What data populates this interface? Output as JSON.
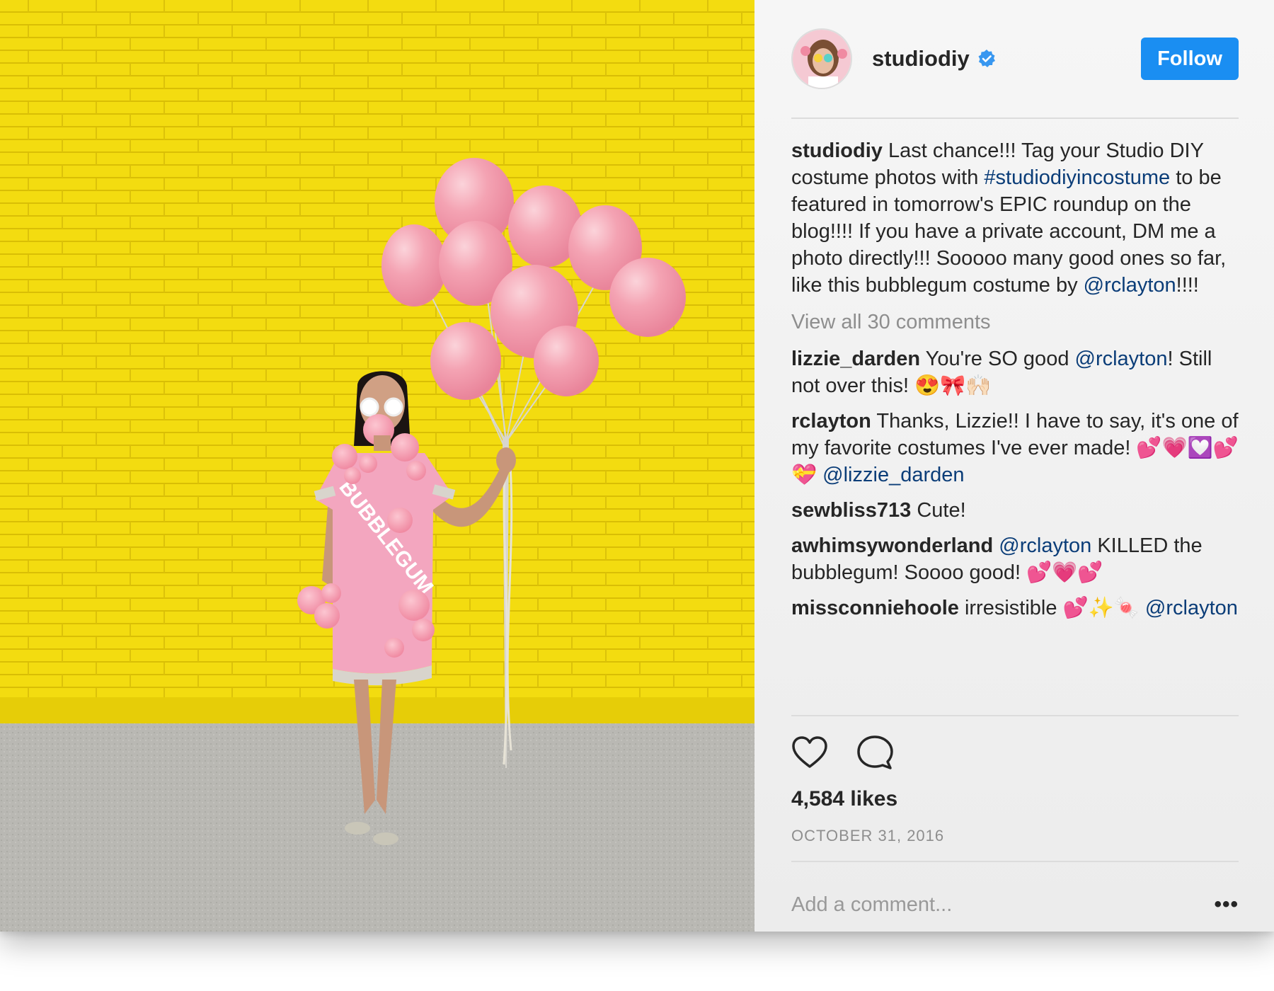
{
  "post": {
    "photo_alt": "Woman in pink bubblegum costume holding pink balloons against a yellow wall",
    "costume_text": "BUBBLEGUM"
  },
  "header": {
    "username": "studiodiy",
    "follow_label": "Follow",
    "accent_color": "#1a8ef2"
  },
  "caption": {
    "author": "studiodiy",
    "text_1": " Last chance!!! Tag your Studio DIY costume photos with ",
    "hashtag": "#studiodiyincostume",
    "text_2": " to be featured in tomorrow's EPIC roundup on the blog!!!! If you have a private account, DM me a photo directly!!! Sooooo many good ones so far, like this bubblegum costume by ",
    "mention": "@rclayton",
    "text_3": "!!!!"
  },
  "view_all": "View all 30 comments",
  "comments": [
    {
      "author": "lizzie_darden",
      "text_1": " You're SO good ",
      "mention": "@rclayton",
      "text_2": "! Still not over this! 😍🎀🙌🏻"
    },
    {
      "author": "rclayton",
      "text_1": " Thanks, Lizzie!! I have to say, it's one of my favorite costumes I've ever made! 💕💗💟💕💝 ",
      "mention": "@lizzie_darden",
      "text_2": ""
    },
    {
      "author": "sewbliss713",
      "text_1": " Cute!",
      "mention": "",
      "text_2": ""
    },
    {
      "author": "awhimsywonderland",
      "text_1": " ",
      "mention": "@rclayton",
      "text_2": " KILLED the bubblegum! Soooo good! 💕💗💕"
    },
    {
      "author": "missconniehoole",
      "text_1": " irresistible 💕✨🍬 ",
      "mention": "@rclayton",
      "text_2": ""
    }
  ],
  "actions": {
    "like_icon": "heart-icon",
    "comment_icon": "comment-bubble-icon"
  },
  "likes": "4,584 likes",
  "date": "OCTOBER 31, 2016",
  "add_comment": {
    "placeholder": "Add a comment...",
    "more_label": "•••"
  }
}
